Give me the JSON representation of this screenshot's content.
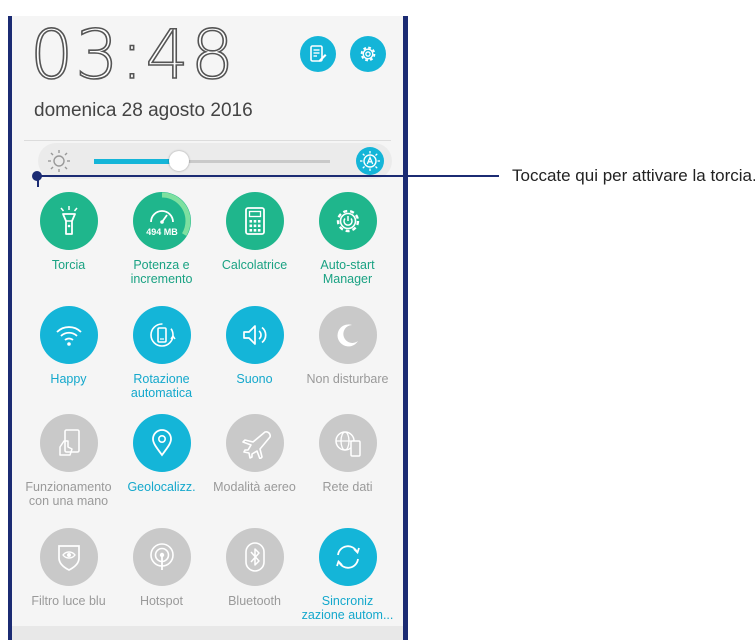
{
  "header": {
    "time": "03:48",
    "date": "domenica 28 agosto 2016",
    "notes_button_icon": "notes-edit-icon",
    "settings_button_icon": "gear-icon"
  },
  "brightness": {
    "level": 0.36,
    "left_icon": "sun-icon",
    "auto_icon": "auto-brightness-icon"
  },
  "tiles": [
    {
      "label": "Torcia",
      "icon": "flashlight-icon",
      "state": "on"
    },
    {
      "label": "Potenza e incremento",
      "icon": "speed-gauge-icon",
      "badge": "494 MB",
      "state": "on"
    },
    {
      "label": "Calcolatrice",
      "icon": "calculator-icon",
      "state": "on"
    },
    {
      "label": "Auto-start Manager",
      "icon": "gear-power-icon",
      "state": "on"
    },
    {
      "label": "Happy",
      "icon": "wifi-icon",
      "state": "on"
    },
    {
      "label": "Rotazione automatica",
      "icon": "auto-rotate-icon",
      "state": "on"
    },
    {
      "label": "Suono",
      "icon": "speaker-icon",
      "state": "on"
    },
    {
      "label": "Non disturbare",
      "icon": "moon-icon",
      "state": "off"
    },
    {
      "label": "Funzionamento con una mano",
      "icon": "one-hand-icon",
      "state": "off"
    },
    {
      "label": "Geolocalizz.",
      "icon": "location-pin-icon",
      "state": "on"
    },
    {
      "label": "Modalità aereo",
      "icon": "airplane-icon",
      "state": "off"
    },
    {
      "label": "Rete dati",
      "icon": "globe-phone-icon",
      "state": "off"
    },
    {
      "label": "Filtro luce blu",
      "icon": "eye-shield-icon",
      "state": "off"
    },
    {
      "label": "Hotspot",
      "icon": "hotspot-icon",
      "state": "off"
    },
    {
      "label": "Bluetooth",
      "icon": "bluetooth-icon",
      "state": "off"
    },
    {
      "label": "Sincroniz zazione autom...",
      "icon": "sync-icon",
      "state": "on"
    }
  ],
  "callout": {
    "text": "Toccate qui per attivare la torcia."
  },
  "colors": {
    "accent_blue": "#14b5d8",
    "accent_green": "#1fb68c",
    "off_gray": "#c9c9c9",
    "frame": "#1b2b73"
  }
}
